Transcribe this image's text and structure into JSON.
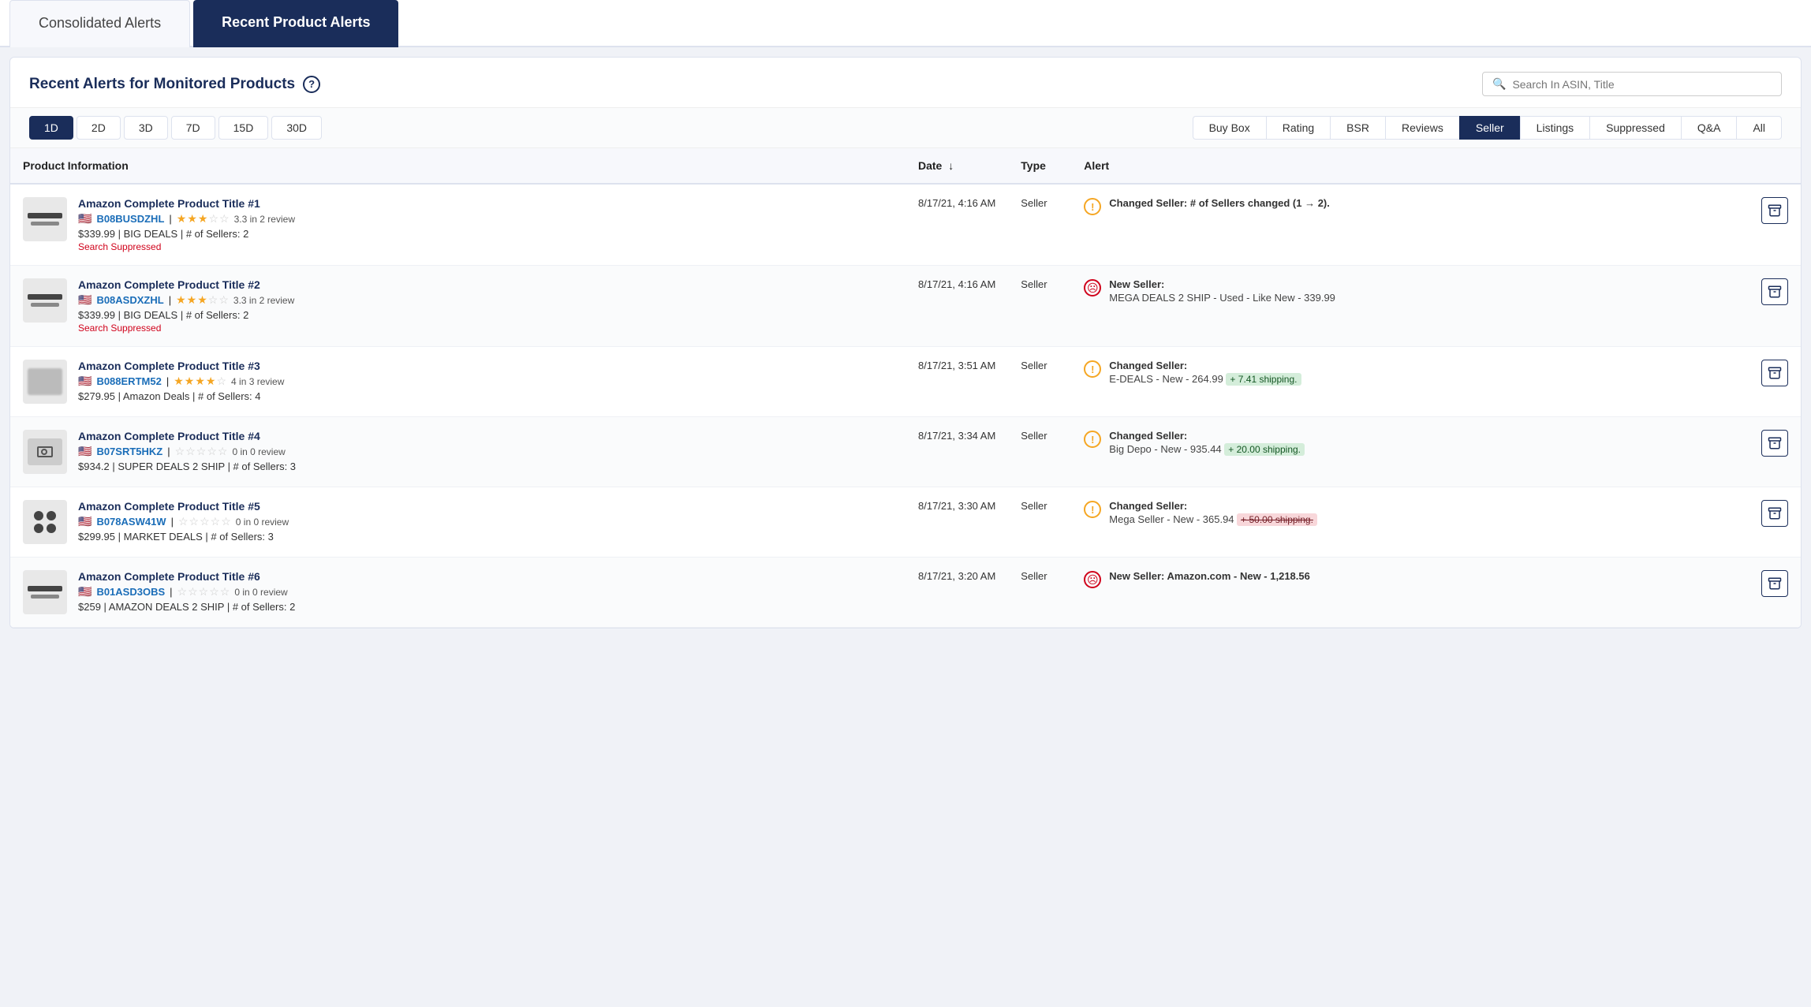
{
  "tabs": [
    {
      "id": "consolidated",
      "label": "Consolidated Alerts",
      "active": false
    },
    {
      "id": "recent",
      "label": "Recent Product Alerts",
      "active": true
    }
  ],
  "panel": {
    "title": "Recent Alerts for Monitored Products",
    "help": "?",
    "search_placeholder": "Search In ASIN, Title"
  },
  "date_filters": [
    {
      "label": "1D",
      "active": true
    },
    {
      "label": "2D",
      "active": false
    },
    {
      "label": "3D",
      "active": false
    },
    {
      "label": "7D",
      "active": false
    },
    {
      "label": "15D",
      "active": false
    },
    {
      "label": "30D",
      "active": false
    }
  ],
  "type_filters": [
    {
      "label": "Buy Box",
      "active": false
    },
    {
      "label": "Rating",
      "active": false
    },
    {
      "label": "BSR",
      "active": false
    },
    {
      "label": "Reviews",
      "active": false
    },
    {
      "label": "Seller",
      "active": true
    },
    {
      "label": "Listings",
      "active": false
    },
    {
      "label": "Suppressed",
      "active": false
    },
    {
      "label": "Q&A",
      "active": false
    },
    {
      "label": "All",
      "active": false
    }
  ],
  "table": {
    "columns": [
      {
        "id": "product",
        "label": "Product Information"
      },
      {
        "id": "date",
        "label": "Date",
        "sortable": true
      },
      {
        "id": "type",
        "label": "Type"
      },
      {
        "id": "alert",
        "label": "Alert"
      },
      {
        "id": "action",
        "label": ""
      }
    ],
    "rows": [
      {
        "id": 1,
        "thumb_type": "bar",
        "title": "Amazon Complete Product Title #1",
        "flag": "🇺🇸",
        "asin": "B08BUSDZHL",
        "stars": 3.3,
        "star_count": 5,
        "filled_stars": 3,
        "half_star": false,
        "review_text": "3.3 in 2 review",
        "price": "$339.99",
        "deal": "BIG DEALS",
        "sellers": "# of Sellers: 2",
        "suppressed": "Search Suppressed",
        "date": "8/17/21, 4:16 AM",
        "type": "Seller",
        "alert_icon": "warning",
        "alert_title": "Changed Seller: # of Sellers changed (1 → 2).",
        "alert_desc": "",
        "alert_highlight": "",
        "alert_highlight_type": ""
      },
      {
        "id": 2,
        "thumb_type": "bar",
        "title": "Amazon Complete Product Title #2",
        "flag": "🇺🇸",
        "asin": "B08ASDXZHL",
        "stars": 3.3,
        "star_count": 5,
        "filled_stars": 3,
        "half_star": false,
        "review_text": "3.3 in 2 review",
        "price": "$339.99",
        "deal": "BIG DEALS",
        "sellers": "# of Sellers: 2",
        "suppressed": "Search Suppressed",
        "date": "8/17/21, 4:16 AM",
        "type": "Seller",
        "alert_icon": "bad",
        "alert_title": "New Seller:",
        "alert_desc": "MEGA DEALS 2 SHIP - Used - Like New - 339.99",
        "alert_highlight": "",
        "alert_highlight_type": ""
      },
      {
        "id": 3,
        "thumb_type": "blurry",
        "title": "Amazon Complete Product Title #3",
        "flag": "🇺🇸",
        "asin": "B088ERTM52",
        "stars": 4.0,
        "star_count": 5,
        "filled_stars": 4,
        "half_star": false,
        "review_text": "4 in 3 review",
        "price": "$279.95",
        "deal": "Amazon Deals",
        "sellers": "# of Sellers: 4",
        "suppressed": "",
        "date": "8/17/21, 3:51 AM",
        "type": "Seller",
        "alert_icon": "warning",
        "alert_title": "Changed Seller:",
        "alert_desc": "E-DEALS - New - 264.99",
        "alert_highlight": "+ 7.41 shipping.",
        "alert_highlight_type": "green"
      },
      {
        "id": 4,
        "thumb_type": "camera",
        "title": "Amazon Complete Product Title #4",
        "flag": "🇺🇸",
        "asin": "B07SRT5HKZ",
        "stars": 0,
        "star_count": 5,
        "filled_stars": 0,
        "half_star": false,
        "review_text": "0 in 0 review",
        "price": "$934.2",
        "deal": "SUPER DEALS 2 SHIP",
        "sellers": "# of Sellers: 3",
        "suppressed": "",
        "date": "8/17/21, 3:34 AM",
        "type": "Seller",
        "alert_icon": "warning",
        "alert_title": "Changed Seller:",
        "alert_desc": "Big Depo - New - 935.44",
        "alert_highlight": "+ 20.00 shipping.",
        "alert_highlight_type": "green"
      },
      {
        "id": 5,
        "thumb_type": "dots",
        "title": "Amazon Complete Product Title #5",
        "flag": "🇺🇸",
        "asin": "B078ASW41W",
        "stars": 0,
        "star_count": 5,
        "filled_stars": 0,
        "half_star": false,
        "review_text": "0 in 0 review",
        "price": "$299.95",
        "deal": "MARKET DEALS",
        "sellers": "# of Sellers: 3",
        "suppressed": "",
        "date": "8/17/21, 3:30 AM",
        "type": "Seller",
        "alert_icon": "warning",
        "alert_title": "Changed Seller:",
        "alert_desc": "Mega Seller - New - 365.94",
        "alert_highlight": "+ 50.00 shipping.",
        "alert_highlight_type": "red"
      },
      {
        "id": 6,
        "thumb_type": "bar2",
        "title": "Amazon Complete Product Title #6",
        "flag": "🇺🇸",
        "asin": "B01ASD3OBS",
        "stars": 0,
        "star_count": 5,
        "filled_stars": 0,
        "half_star": false,
        "review_text": "0 in 0 review",
        "price": "$259",
        "deal": "AMAZON DEALS 2 SHIP",
        "sellers": "# of Sellers: 2",
        "suppressed": "",
        "date": "8/17/21, 3:20 AM",
        "type": "Seller",
        "alert_icon": "bad",
        "alert_title": "New Seller: Amazon.com - New - 1,218.56",
        "alert_desc": "",
        "alert_highlight": "",
        "alert_highlight_type": ""
      }
    ]
  },
  "icons": {
    "search": "🔍",
    "sort_down": "↓",
    "arrow_right": "→",
    "archive": "🗂"
  }
}
